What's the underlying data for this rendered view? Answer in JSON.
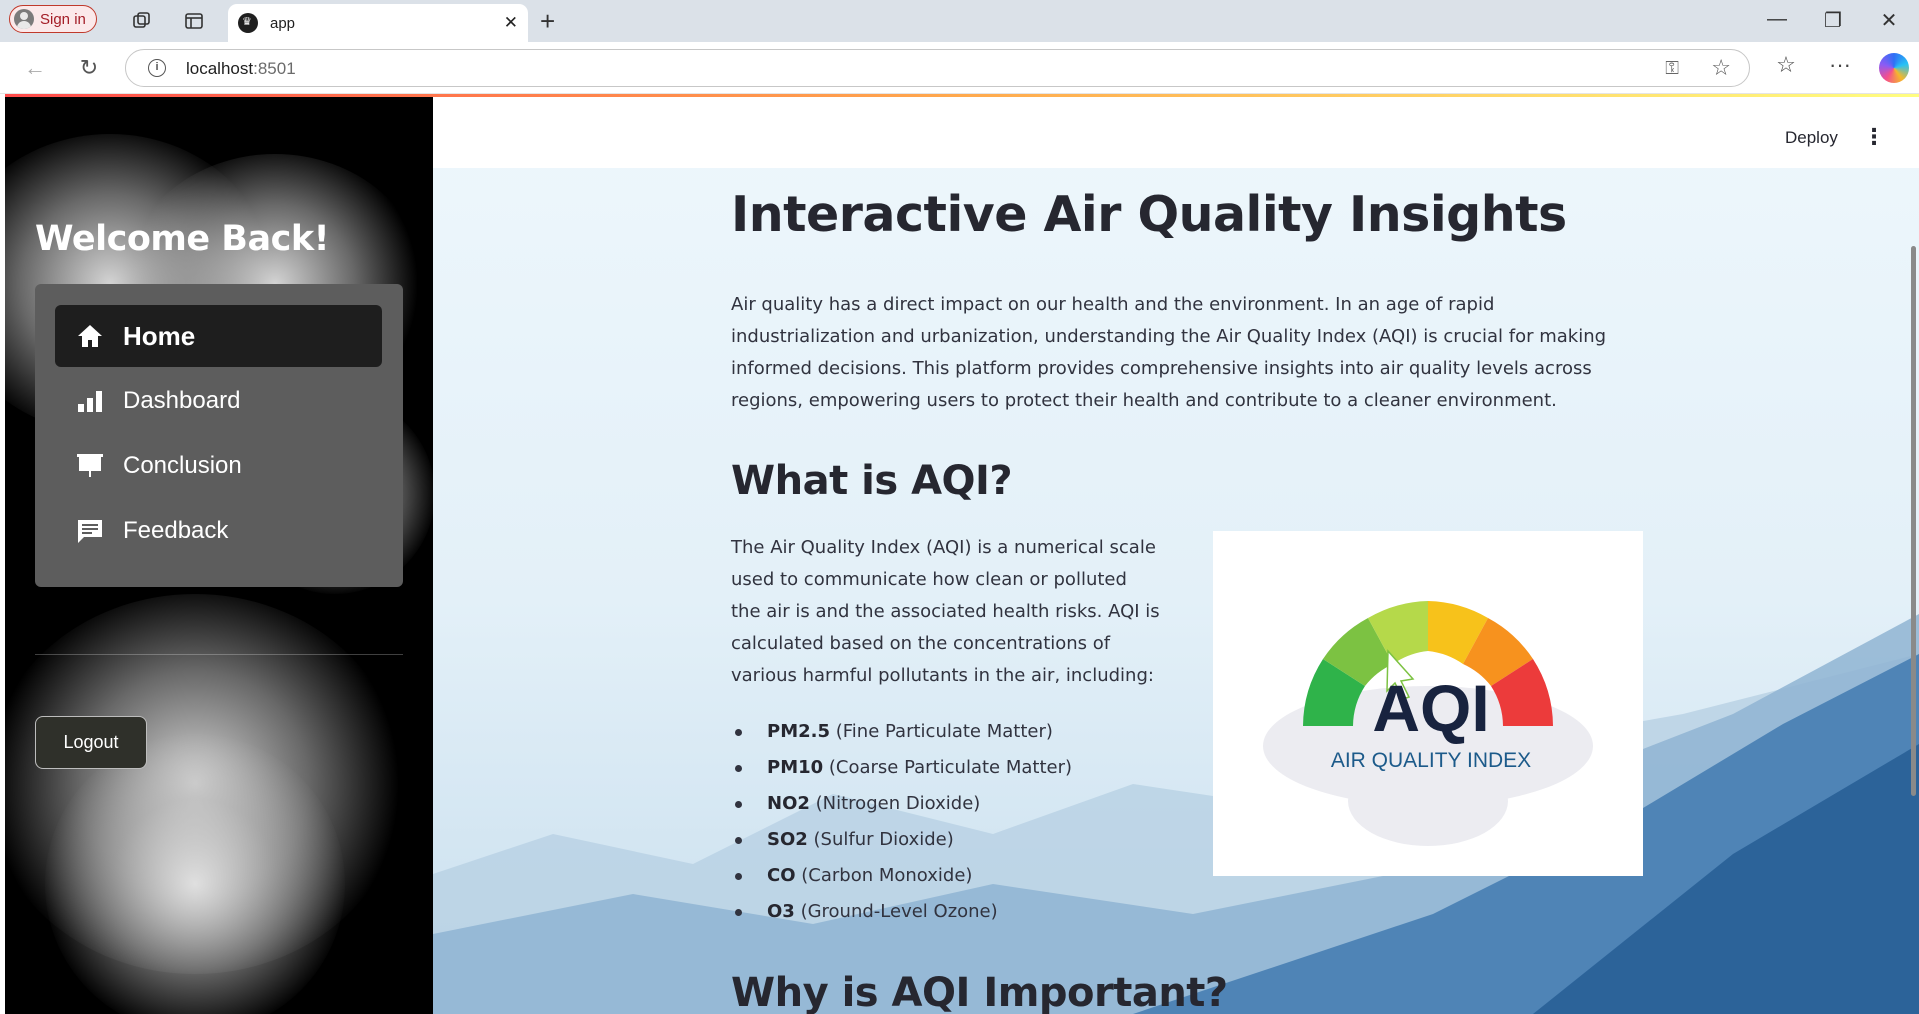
{
  "browser": {
    "signin_label": "Sign in",
    "tab_title": "app",
    "url_host": "localhost",
    "url_port": ":8501"
  },
  "sidebar": {
    "welcome": "Welcome Back!",
    "menu": [
      {
        "label": "Home",
        "icon": "house-icon",
        "active": true
      },
      {
        "label": "Dashboard",
        "icon": "bar-chart-icon",
        "active": false
      },
      {
        "label": "Conclusion",
        "icon": "presentation-board-icon",
        "active": false
      },
      {
        "label": "Feedback",
        "icon": "message-icon",
        "active": false
      }
    ],
    "logout_label": "Logout"
  },
  "header": {
    "deploy_label": "Deploy"
  },
  "main": {
    "title": "Interactive Air Quality Insights",
    "intro": "Air quality has a direct impact on our health and the environment. In an age of rapid industrialization and urbanization, understanding the Air Quality Index (AQI) is crucial for making informed decisions. This platform provides comprehensive insights into air quality levels across regions, empowering users to protect their health and contribute to a cleaner environment.",
    "what_heading": "What is AQI?",
    "what_text": "The Air Quality Index (AQI) is a numerical scale used to communicate how clean or polluted the air is and the associated health risks. AQI is calculated based on the concentrations of various harmful pollutants in the air, including:",
    "pollutants": [
      {
        "code": "PM2.5",
        "name": "(Fine Particulate Matter)"
      },
      {
        "code": "PM10",
        "name": "(Coarse Particulate Matter)"
      },
      {
        "code": "NO2",
        "name": "(Nitrogen Dioxide)"
      },
      {
        "code": "SO2",
        "name": "(Sulfur Dioxide)"
      },
      {
        "code": "CO",
        "name": "(Carbon Monoxide)"
      },
      {
        "code": "O3",
        "name": "(Ground-Level Ozone)"
      }
    ],
    "why_heading": "Why is AQI Important?",
    "aqi_logo": {
      "big_text": "AQI",
      "sub_text": "AIR QUALITY INDEX",
      "colors": [
        "#2fb34a",
        "#7cc242",
        "#b5d94a",
        "#f7c21b",
        "#f7921e",
        "#ec3b3b"
      ]
    }
  },
  "colors": {
    "sidebar_bg": "#000000",
    "menu_card_bg": "#5d5d5d",
    "menu_active_bg": "#1e1e1e",
    "text_primary": "#262730"
  }
}
